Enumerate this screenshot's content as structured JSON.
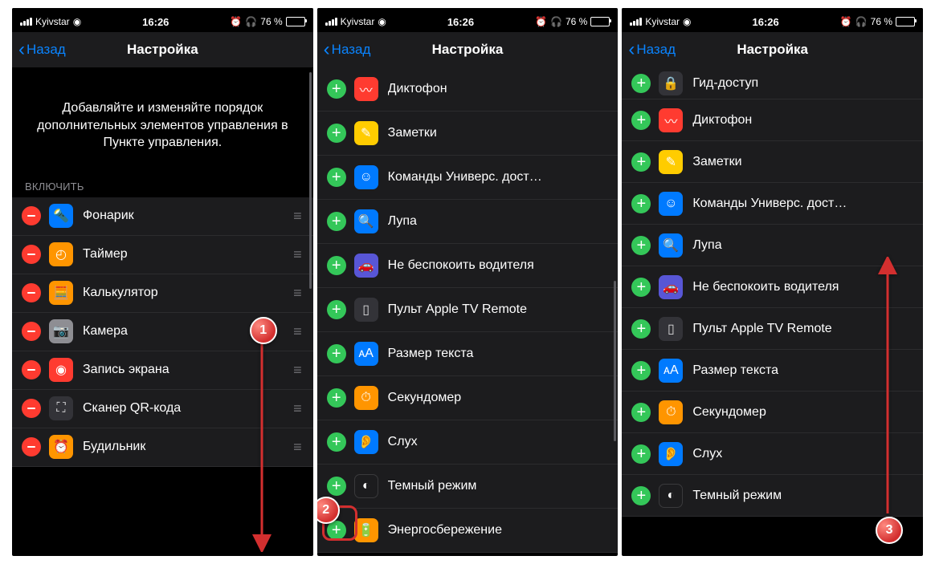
{
  "status": {
    "carrier": "Kyivstar",
    "time": "16:26",
    "battery_pct": "76 %"
  },
  "nav": {
    "back": "Назад",
    "title": "Настройка"
  },
  "s1": {
    "intro": "Добавляйте и изменяйте порядок дополнительных элементов управления в Пункте управления.",
    "section": "ВКЛЮЧИТЬ",
    "items": [
      {
        "label": "Фонарик",
        "icon": "🔦",
        "cls": "i-blue"
      },
      {
        "label": "Таймер",
        "icon": "◴",
        "cls": "i-orange"
      },
      {
        "label": "Калькулятор",
        "icon": "🧮",
        "cls": "i-orange"
      },
      {
        "label": "Камера",
        "icon": "📷",
        "cls": "i-grey"
      },
      {
        "label": "Запись экрана",
        "icon": "◉",
        "cls": "i-red"
      },
      {
        "label": "Сканер QR-кода",
        "icon": "⛶",
        "cls": "i-dgrey"
      },
      {
        "label": "Будильник",
        "icon": "⏰",
        "cls": "i-orange"
      }
    ]
  },
  "s2": {
    "items": [
      {
        "label": "Диктофон",
        "icon": "〰",
        "cls": "i-red"
      },
      {
        "label": "Заметки",
        "icon": "✎",
        "cls": "i-yellow"
      },
      {
        "label": "Команды Универс. дост…",
        "icon": "☺",
        "cls": "i-blue"
      },
      {
        "label": "Лупа",
        "icon": "🔍",
        "cls": "i-blue"
      },
      {
        "label": "Не беспокоить водителя",
        "icon": "🚗",
        "cls": "i-nav"
      },
      {
        "label": "Пульт Apple TV Remote",
        "icon": "▯",
        "cls": "i-dgrey"
      },
      {
        "label": "Размер текста",
        "icon": "ᴀA",
        "cls": "i-blue"
      },
      {
        "label": "Секундомер",
        "icon": "⏱",
        "cls": "i-orange"
      },
      {
        "label": "Слух",
        "icon": "👂",
        "cls": "i-blue"
      },
      {
        "label": "Темный режим",
        "icon": "◐",
        "cls": "i-dark"
      },
      {
        "label": "Энергосбережение",
        "icon": "🔋",
        "cls": "i-orange"
      }
    ]
  },
  "s3": {
    "items": [
      {
        "label": "Гид-доступ",
        "icon": "🔒",
        "cls": "i-dgrey"
      },
      {
        "label": "Диктофон",
        "icon": "〰",
        "cls": "i-red"
      },
      {
        "label": "Заметки",
        "icon": "✎",
        "cls": "i-yellow"
      },
      {
        "label": "Команды Универс. дост…",
        "icon": "☺",
        "cls": "i-blue"
      },
      {
        "label": "Лупа",
        "icon": "🔍",
        "cls": "i-blue"
      },
      {
        "label": "Не беспокоить водителя",
        "icon": "🚗",
        "cls": "i-nav"
      },
      {
        "label": "Пульт Apple TV Remote",
        "icon": "▯",
        "cls": "i-dgrey"
      },
      {
        "label": "Размер текста",
        "icon": "ᴀA",
        "cls": "i-blue"
      },
      {
        "label": "Секундомер",
        "icon": "⏱",
        "cls": "i-orange"
      },
      {
        "label": "Слух",
        "icon": "👂",
        "cls": "i-blue"
      },
      {
        "label": "Темный режим",
        "icon": "◐",
        "cls": "i-dark"
      }
    ]
  },
  "callouts": {
    "c1": "1",
    "c2": "2",
    "c3": "3"
  }
}
